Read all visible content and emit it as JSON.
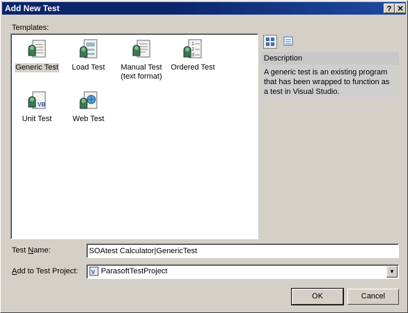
{
  "window": {
    "title": "Add New Test",
    "help_label": "?",
    "close_label": "✕"
  },
  "templates": {
    "label": "Templates:",
    "items": [
      {
        "label": "Generic Test",
        "icon": "generic-test-icon",
        "selected": true
      },
      {
        "label": "Load Test",
        "icon": "load-test-icon",
        "selected": false
      },
      {
        "label": "Manual Test (text format)",
        "label_line1": "Manual Test",
        "label_line2": "(text format)",
        "icon": "manual-test-icon",
        "selected": false
      },
      {
        "label": "Ordered Test",
        "icon": "ordered-test-icon",
        "selected": false
      },
      {
        "label": "Unit Test",
        "icon": "unit-test-icon",
        "selected": false
      },
      {
        "label": "Web Test",
        "icon": "web-test-icon",
        "selected": false
      }
    ]
  },
  "description": {
    "header": "Description",
    "text": "A generic test is an existing program that has been wrapped to function as a test in Visual Studio."
  },
  "form": {
    "test_name_label_pre": "Test ",
    "test_name_label_key": "N",
    "test_name_label_post": "ame:",
    "test_name_value": "SOAtest Calculator|GenericTest",
    "project_label_key": "A",
    "project_label_post": "dd to Test Project:",
    "project_value": "ParasoftTestProject"
  },
  "buttons": {
    "ok": "OK",
    "cancel": "Cancel"
  }
}
